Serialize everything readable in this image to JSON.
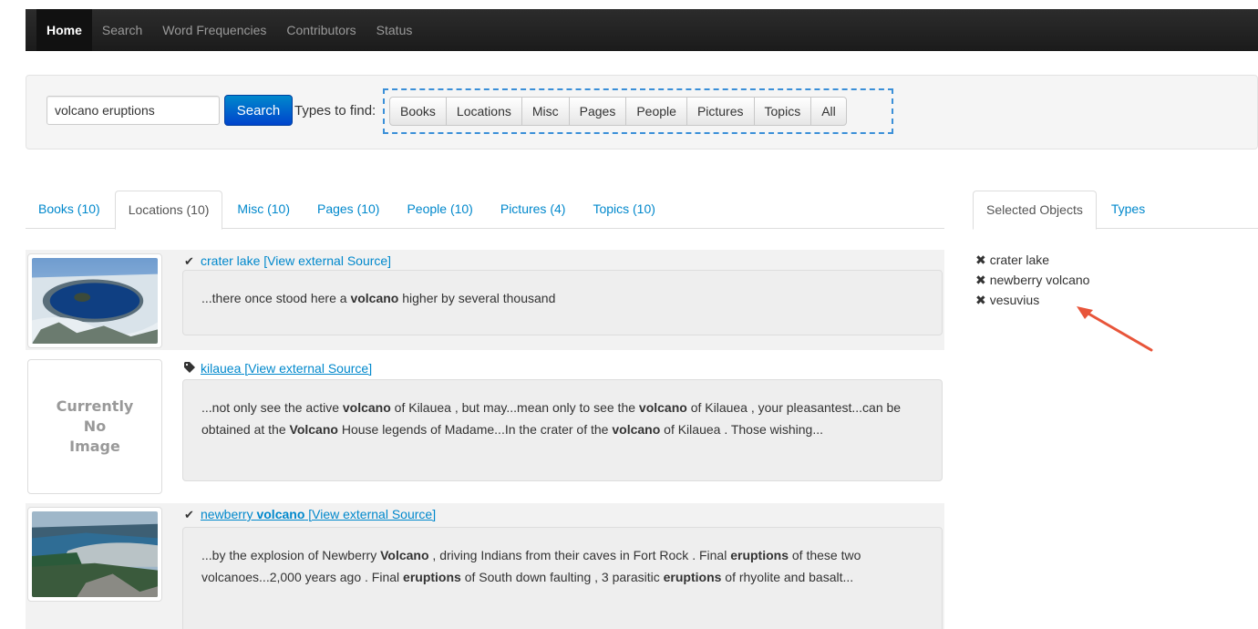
{
  "navbar": {
    "items": [
      "Home",
      "Search",
      "Word Frequencies",
      "Contributors",
      "Status"
    ],
    "active": "Home"
  },
  "search": {
    "query": "volcano eruptions",
    "button_label": "Search",
    "types_label": "Types to find:",
    "types": [
      "Books",
      "Locations",
      "Misc",
      "Pages",
      "People",
      "Pictures",
      "Topics",
      "All"
    ]
  },
  "tabs": {
    "items": [
      "Books (10)",
      "Locations (10)",
      "Misc (10)",
      "Pages (10)",
      "People (10)",
      "Pictures (4)",
      "Topics (10)"
    ],
    "active": "Locations (10)"
  },
  "side_tabs": {
    "items": [
      "Selected Objects",
      "Types"
    ],
    "active": "Selected Objects"
  },
  "results": [
    {
      "icon": "check-icon",
      "name": "crater lake",
      "link_suffix": " [View external Source]",
      "has_image": true,
      "snippet": "...there once stood here a <b>volcano</b> higher by several thousand"
    },
    {
      "icon": "tag-icon",
      "name": "kilauea",
      "link_suffix": " [View external Source]",
      "has_image": false,
      "no_image_text": [
        "Currently",
        "No",
        "Image"
      ],
      "snippet": "...not only see the active <b>volcano</b> of Kilauea , but may...mean only to see the <b>volcano</b> of Kilauea , your pleasantest...can be obtained at the <b>Volcano</b> House legends of Madame...In the crater of the <b>volcano</b> of Kilauea . Those wishing..."
    },
    {
      "icon": "check-icon",
      "name_prefix": "newberry ",
      "name_bold": "volcano",
      "link_suffix": " [View external Source]",
      "has_image": true,
      "snippet": "...by the explosion of Newberry <b>Volcano</b> , driving Indians from their caves in Fort Rock . Final <b>eruptions</b> of these two volcanoes...2,000 years ago . Final <b>eruptions</b> of South down faulting , 3 parasitic <b>eruptions</b> of rhyolite and basalt..."
    }
  ],
  "selected_objects": [
    "crater lake",
    "newberry volcano",
    "vesuvius"
  ],
  "colors": {
    "link": "#0088cc",
    "primary_button": "#0066cc",
    "annotation_arrow": "#e8553a",
    "dashed_outline": "#3a8fd8"
  }
}
